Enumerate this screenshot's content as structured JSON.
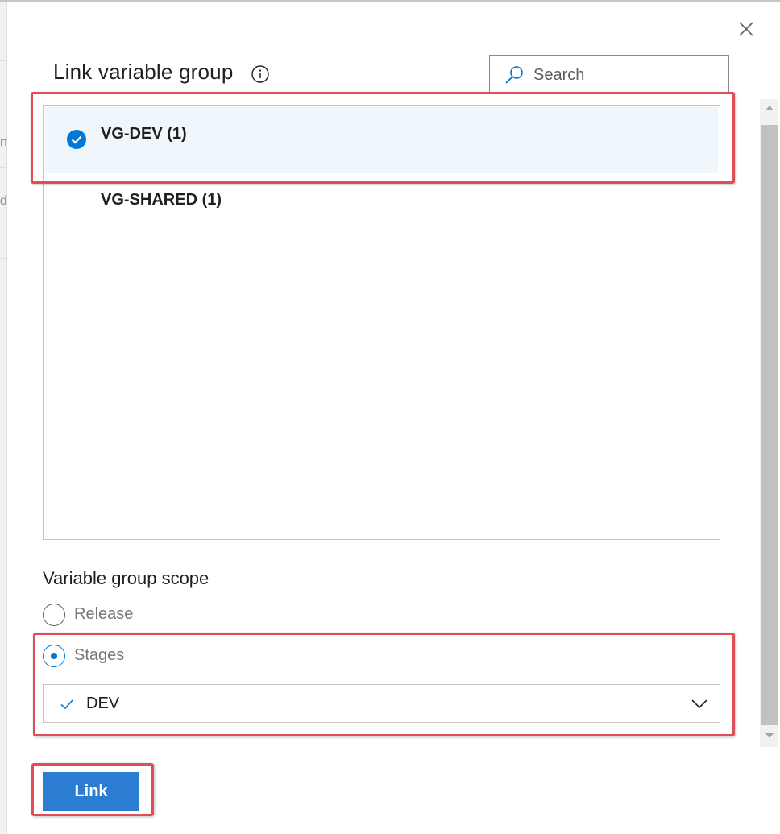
{
  "dialog": {
    "title": "Link variable group"
  },
  "search": {
    "placeholder": "Search",
    "value": ""
  },
  "variable_groups": [
    {
      "label": "VG-DEV (1)",
      "selected": true
    },
    {
      "label": "VG-SHARED (1)",
      "selected": false
    }
  ],
  "scope": {
    "title": "Variable group scope",
    "options": [
      {
        "label": "Release",
        "checked": false
      },
      {
        "label": "Stages",
        "checked": true
      }
    ],
    "stages_dropdown": {
      "selected_value": "DEV"
    }
  },
  "actions": {
    "link_label": "Link"
  },
  "background_fragments": [
    "n",
    "d"
  ],
  "colors": {
    "accent": "#0078d4",
    "primary_button": "#2b7cd3",
    "selected_row": "#eff6fc",
    "highlight_annotation": "#e04e55"
  },
  "icons": {
    "close": "close-icon",
    "info": "info-icon",
    "search": "search-icon",
    "checked_item": "check-circle-icon",
    "dropdown_check": "checkmark-icon",
    "dropdown": "chevron-down-icon"
  }
}
